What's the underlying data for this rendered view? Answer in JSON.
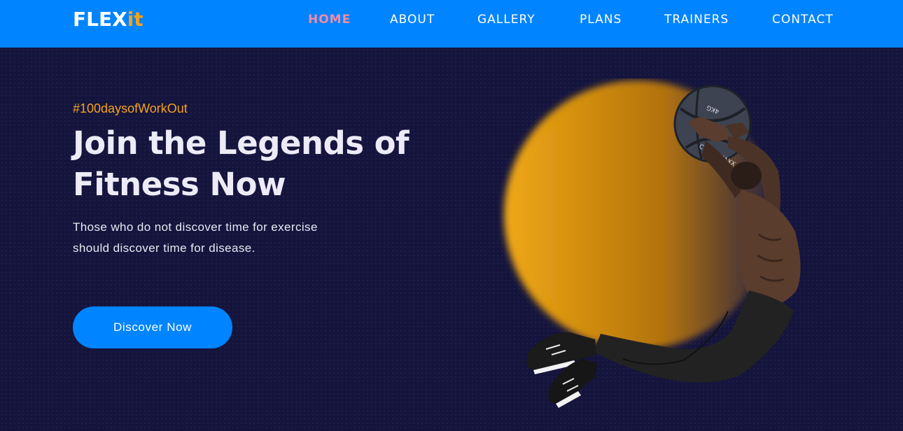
{
  "brand": {
    "logo_part1": "FLEX",
    "logo_part2": "it",
    "primary_color": "#0084ff",
    "accent_color": "#f5a21c",
    "background_color": "#14143d"
  },
  "nav": {
    "items": [
      {
        "label": "HOME",
        "active": true
      },
      {
        "label": "ABOUT",
        "active": false
      },
      {
        "label": "GALLERY",
        "active": false
      },
      {
        "label": "PLANS",
        "active": false
      },
      {
        "label": "TRAINERS",
        "active": false
      },
      {
        "label": "CONTACT",
        "active": false
      }
    ],
    "active_color": "#f48aa8"
  },
  "hero": {
    "tagline": "#100daysofWorkOut",
    "headline": "Join the Legends of Fitness Now",
    "description": "Those who do not discover time for exercise should discover time for disease.",
    "cta_label": "Discover Now",
    "ball_text": "CROSSMAXX",
    "ball_weight": "4KG"
  }
}
